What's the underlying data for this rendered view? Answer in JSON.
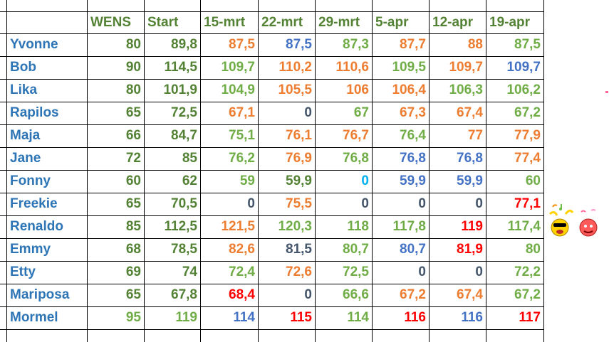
{
  "colors": {
    "dark_green": "#548235",
    "light_green": "#70ad47",
    "orange": "#ed7d31",
    "blue": "#4472c4",
    "navy": "#44546a",
    "cyan": "#00b0f0",
    "red": "#ff0000",
    "name_blue": "#2e75b6"
  },
  "header": {
    "empty": "",
    "columns": [
      "WENS",
      "Start",
      "15-mrt",
      "22-mrt",
      "29-mrt",
      "5-apr",
      "12-apr",
      "19-apr"
    ]
  },
  "rows": [
    {
      "name": "Yvonne",
      "values": [
        {
          "v": "80",
          "c": "dark_green"
        },
        {
          "v": "89,8",
          "c": "dark_green"
        },
        {
          "v": "87,5",
          "c": "orange"
        },
        {
          "v": "87,5",
          "c": "blue"
        },
        {
          "v": "87,3",
          "c": "light_green"
        },
        {
          "v": "87,7",
          "c": "orange"
        },
        {
          "v": "88",
          "c": "orange"
        },
        {
          "v": "87,5",
          "c": "light_green"
        }
      ]
    },
    {
      "name": "Bob",
      "values": [
        {
          "v": "90",
          "c": "dark_green"
        },
        {
          "v": "114,5",
          "c": "dark_green"
        },
        {
          "v": "109,7",
          "c": "light_green"
        },
        {
          "v": "110,2",
          "c": "orange"
        },
        {
          "v": "110,6",
          "c": "orange"
        },
        {
          "v": "109,5",
          "c": "light_green"
        },
        {
          "v": "109,7",
          "c": "orange"
        },
        {
          "v": "109,7",
          "c": "blue"
        }
      ]
    },
    {
      "name": "Lika",
      "values": [
        {
          "v": "80",
          "c": "dark_green"
        },
        {
          "v": "101,9",
          "c": "dark_green"
        },
        {
          "v": "104,9",
          "c": "light_green"
        },
        {
          "v": "105,5",
          "c": "orange"
        },
        {
          "v": "106",
          "c": "orange"
        },
        {
          "v": "106,4",
          "c": "orange"
        },
        {
          "v": "106,3",
          "c": "light_green"
        },
        {
          "v": "106,2",
          "c": "light_green"
        }
      ]
    },
    {
      "name": "Rapilos",
      "values": [
        {
          "v": "65",
          "c": "dark_green"
        },
        {
          "v": "72,5",
          "c": "dark_green"
        },
        {
          "v": "67,1",
          "c": "orange"
        },
        {
          "v": "0",
          "c": "navy"
        },
        {
          "v": "67",
          "c": "light_green"
        },
        {
          "v": "67,3",
          "c": "orange"
        },
        {
          "v": "67,4",
          "c": "orange"
        },
        {
          "v": "67,2",
          "c": "light_green"
        }
      ]
    },
    {
      "name": "Maja",
      "values": [
        {
          "v": "66",
          "c": "dark_green"
        },
        {
          "v": "84,7",
          "c": "dark_green"
        },
        {
          "v": "75,1",
          "c": "light_green"
        },
        {
          "v": "76,1",
          "c": "orange"
        },
        {
          "v": "76,7",
          "c": "orange"
        },
        {
          "v": "76,4",
          "c": "light_green"
        },
        {
          "v": "77",
          "c": "orange"
        },
        {
          "v": "77,9",
          "c": "orange"
        }
      ]
    },
    {
      "name": "Jane",
      "values": [
        {
          "v": "72",
          "c": "dark_green"
        },
        {
          "v": "85",
          "c": "dark_green"
        },
        {
          "v": "76,2",
          "c": "light_green"
        },
        {
          "v": "76,9",
          "c": "orange"
        },
        {
          "v": "76,8",
          "c": "light_green"
        },
        {
          "v": "76,8",
          "c": "blue"
        },
        {
          "v": "76,8",
          "c": "blue"
        },
        {
          "v": "77,4",
          "c": "orange"
        }
      ]
    },
    {
      "name": "Fonny",
      "values": [
        {
          "v": "60",
          "c": "dark_green"
        },
        {
          "v": "62",
          "c": "dark_green"
        },
        {
          "v": "59",
          "c": "light_green"
        },
        {
          "v": "59,9",
          "c": "dark_green"
        },
        {
          "v": "0",
          "c": "cyan"
        },
        {
          "v": "59,9",
          "c": "blue"
        },
        {
          "v": "59,9",
          "c": "blue"
        },
        {
          "v": "60",
          "c": "light_green"
        }
      ]
    },
    {
      "name": "Freekie",
      "values": [
        {
          "v": "65",
          "c": "dark_green"
        },
        {
          "v": "70,5",
          "c": "dark_green"
        },
        {
          "v": "0",
          "c": "navy"
        },
        {
          "v": "75,5",
          "c": "orange"
        },
        {
          "v": "0",
          "c": "navy"
        },
        {
          "v": "0",
          "c": "navy"
        },
        {
          "v": "0",
          "c": "navy"
        },
        {
          "v": "77,1",
          "c": "red"
        }
      ]
    },
    {
      "name": "Renaldo",
      "values": [
        {
          "v": "85",
          "c": "dark_green"
        },
        {
          "v": "112,5",
          "c": "dark_green"
        },
        {
          "v": "121,5",
          "c": "orange"
        },
        {
          "v": "120,3",
          "c": "light_green"
        },
        {
          "v": "118",
          "c": "light_green"
        },
        {
          "v": "117,8",
          "c": "light_green"
        },
        {
          "v": "119",
          "c": "red"
        },
        {
          "v": "117,4",
          "c": "light_green"
        }
      ]
    },
    {
      "name": "Emmy",
      "values": [
        {
          "v": "68",
          "c": "dark_green"
        },
        {
          "v": "78,5",
          "c": "dark_green"
        },
        {
          "v": "82,6",
          "c": "orange"
        },
        {
          "v": "81,5",
          "c": "navy"
        },
        {
          "v": "80,7",
          "c": "light_green"
        },
        {
          "v": "80,7",
          "c": "blue"
        },
        {
          "v": "81,9",
          "c": "red"
        },
        {
          "v": "80",
          "c": "light_green"
        }
      ]
    },
    {
      "name": "Etty",
      "values": [
        {
          "v": "69",
          "c": "dark_green"
        },
        {
          "v": "74",
          "c": "dark_green"
        },
        {
          "v": "72,4",
          "c": "light_green"
        },
        {
          "v": "72,6",
          "c": "orange"
        },
        {
          "v": "72,5",
          "c": "light_green"
        },
        {
          "v": "0",
          "c": "navy"
        },
        {
          "v": "0",
          "c": "navy"
        },
        {
          "v": "72,2",
          "c": "light_green"
        }
      ]
    },
    {
      "name": "Mariposa",
      "values": [
        {
          "v": "65",
          "c": "dark_green"
        },
        {
          "v": "67,8",
          "c": "dark_green"
        },
        {
          "v": "68,4",
          "c": "red"
        },
        {
          "v": "0",
          "c": "navy"
        },
        {
          "v": "66,6",
          "c": "light_green"
        },
        {
          "v": "67,2",
          "c": "orange"
        },
        {
          "v": "67,4",
          "c": "orange"
        },
        {
          "v": "67,2",
          "c": "light_green"
        }
      ]
    },
    {
      "name": "Mormel",
      "values": [
        {
          "v": "95",
          "c": "light_green"
        },
        {
          "v": "119",
          "c": "light_green"
        },
        {
          "v": "114",
          "c": "blue"
        },
        {
          "v": "115",
          "c": "red"
        },
        {
          "v": "114",
          "c": "light_green"
        },
        {
          "v": "116",
          "c": "red"
        },
        {
          "v": "116",
          "c": "blue"
        },
        {
          "v": "117",
          "c": "red"
        }
      ]
    }
  ],
  "decorations": {
    "party_smiley_icon": "dancing-smiley-icon",
    "blush_smiley_icon": "blushing-smiley-icon"
  }
}
